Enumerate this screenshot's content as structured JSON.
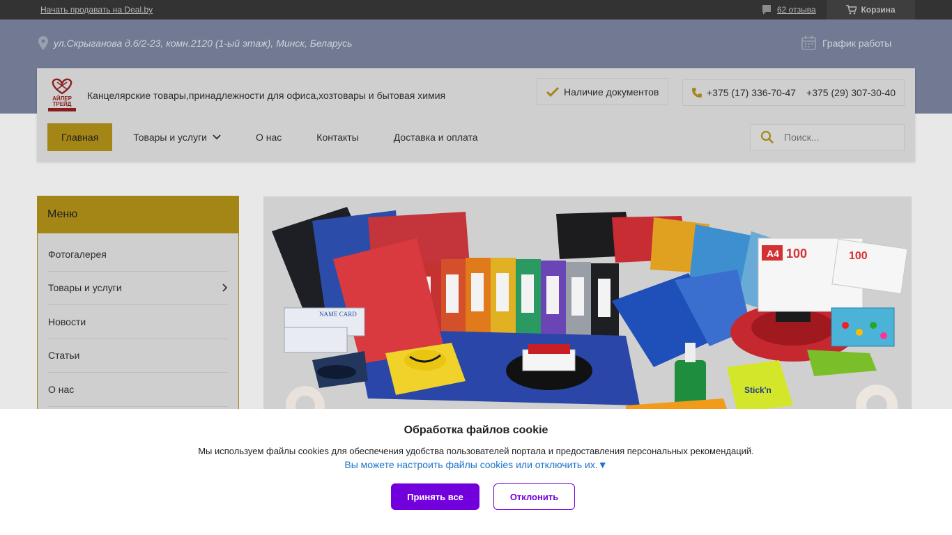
{
  "topbar": {
    "sell_link": "Начать продавать на Deal.by",
    "reviews": "62 отзыва",
    "cart": "Корзина"
  },
  "header": {
    "address": "ул.Скрыганова д.6/2-23, комн.2120 (1-ый этаж), Минск, Беларусь",
    "schedule": "График работы",
    "logo_text": [
      "АЙЛЕР",
      "ТРЕЙД"
    ],
    "tagline": "Канцелярские товары,принадлежности для офиса,хозтовары и бытовая химия",
    "docs": "Наличие документов",
    "phone1": "+375 (17) 336-70-47",
    "phone2": "+375 (29) 307-30-40"
  },
  "nav": {
    "items": [
      {
        "label": "Главная",
        "active": true
      },
      {
        "label": "Товары и услуги",
        "has_dropdown": true
      },
      {
        "label": "О нас"
      },
      {
        "label": "Контакты"
      },
      {
        "label": "Доставка и оплата"
      }
    ]
  },
  "search": {
    "placeholder": "Поиск..."
  },
  "sidebar": {
    "title": "Меню",
    "items": [
      {
        "label": "Фотогалерея"
      },
      {
        "label": "Товары и услуги",
        "has_submenu": true
      },
      {
        "label": "Новости"
      },
      {
        "label": "Статьи"
      },
      {
        "label": "О нас"
      }
    ]
  },
  "banner": {
    "label_a4": "A4",
    "label_100": "100",
    "label_100b": "100",
    "label_namecard": "NAME CARD",
    "label_stickn": "Stick'n"
  },
  "cookie": {
    "title": "Обработка файлов cookie",
    "text": "Мы используем файлы cookies для обеспечения удобства пользователей портала и предоставления персональных рекомендаций.",
    "link": "Вы можете настроить файлы cookies или отключить их.▼",
    "accept": "Принять все",
    "decline": "Отклонить"
  },
  "colors": {
    "accent": "#a48617",
    "band": "#717a92",
    "topbar": "#333333",
    "cookie_button": "#7200dc",
    "cookie_link": "#1a73c9"
  }
}
